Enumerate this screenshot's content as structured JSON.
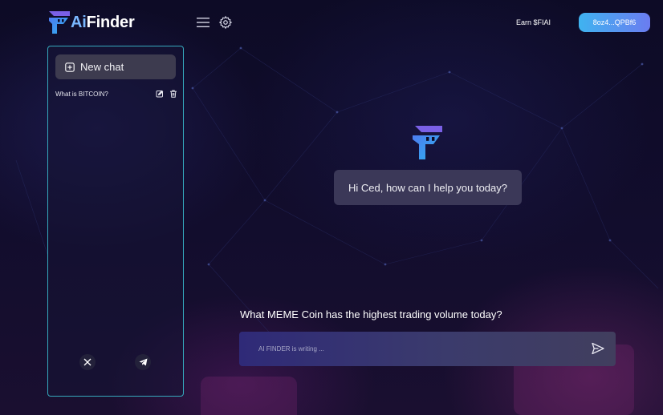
{
  "header": {
    "logo_ai": "Ai",
    "logo_finder": "Finder",
    "earn_label": "Earn $FIAI",
    "wallet_label": "8oz4...QPBf6"
  },
  "sidebar": {
    "new_chat_label": "New chat",
    "history": [
      {
        "label": "What is BITCOIN?"
      }
    ]
  },
  "chat": {
    "greeting": "Hi Ced, how can I help you today?",
    "user_question": "What MEME Coin has the highest trading volume today?"
  },
  "composer": {
    "placeholder": "AI FINDER is writing ..."
  },
  "icons": {
    "menu": "hamburger-icon",
    "settings": "gear-icon",
    "new_chat": "plus-square-icon",
    "edit": "edit-icon",
    "delete": "trash-icon",
    "x_social": "x-logo-icon",
    "telegram": "telegram-icon",
    "send": "send-icon"
  },
  "colors": {
    "accent_cyan": "#3fb3f0",
    "accent_violet": "#6b7cf0",
    "sidebar_border": "#35a9bd",
    "bubble": "#3b3858"
  }
}
